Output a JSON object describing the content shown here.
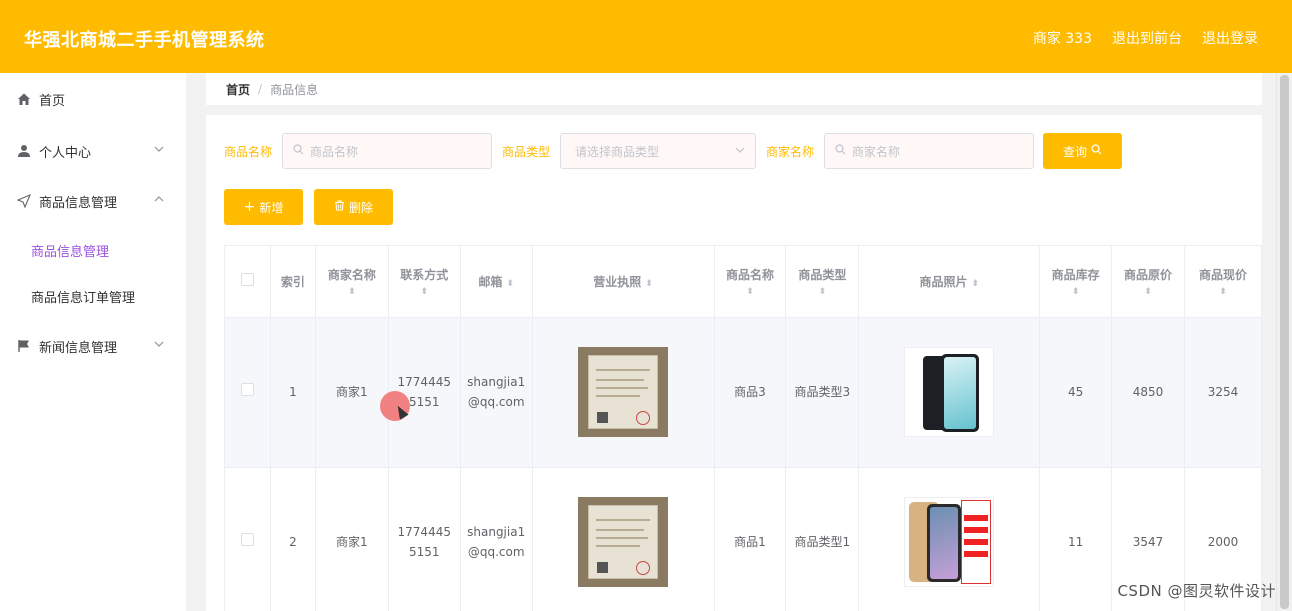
{
  "header": {
    "title": "华强北商城二手手机管理系统",
    "merchant": "商家 333",
    "exit_front": "退出到前台",
    "logout": "退出登录"
  },
  "sidebar": {
    "items": [
      {
        "label": "首页",
        "icon": "home-icon"
      },
      {
        "label": "个人中心",
        "icon": "user-icon"
      },
      {
        "label": "商品信息管理",
        "icon": "send-icon"
      },
      {
        "label": "新闻信息管理",
        "icon": "flag-icon"
      }
    ],
    "subitems": [
      {
        "label": "商品信息管理",
        "active": true
      },
      {
        "label": "商品信息订单管理",
        "active": false
      }
    ]
  },
  "breadcrumb": {
    "home": "首页",
    "sep": "/",
    "current": "商品信息"
  },
  "search": {
    "name_label": "商品名称",
    "name_placeholder": "商品名称",
    "type_label": "商品类型",
    "type_placeholder": "请选择商品类型",
    "merchant_label": "商家名称",
    "merchant_placeholder": "商家名称",
    "query_btn": "查询"
  },
  "actions": {
    "add": "新增",
    "delete": "删除"
  },
  "table": {
    "headers": [
      "索引",
      "商家名称",
      "联系方式",
      "邮箱",
      "营业执照",
      "商品名称",
      "商品类型",
      "商品照片",
      "商品库存",
      "商品原价",
      "商品现价"
    ],
    "rows": [
      {
        "index": "1",
        "merchant": "商家1",
        "phone": "17744455151",
        "email": "shangjia1@qq.com",
        "name": "商品3",
        "type": "商品类型3",
        "stock": "45",
        "orig": "4850",
        "price": "3254"
      },
      {
        "index": "2",
        "merchant": "商家1",
        "phone": "17744455151",
        "email": "shangjia1@qq.com",
        "name": "商品1",
        "type": "商品类型1",
        "stock": "11",
        "orig": "3547",
        "price": "2000"
      }
    ]
  },
  "watermark": "CSDN @图灵软件设计",
  "colors": {
    "accent": "#ffbb00",
    "active_sub": "#9b51e0"
  }
}
